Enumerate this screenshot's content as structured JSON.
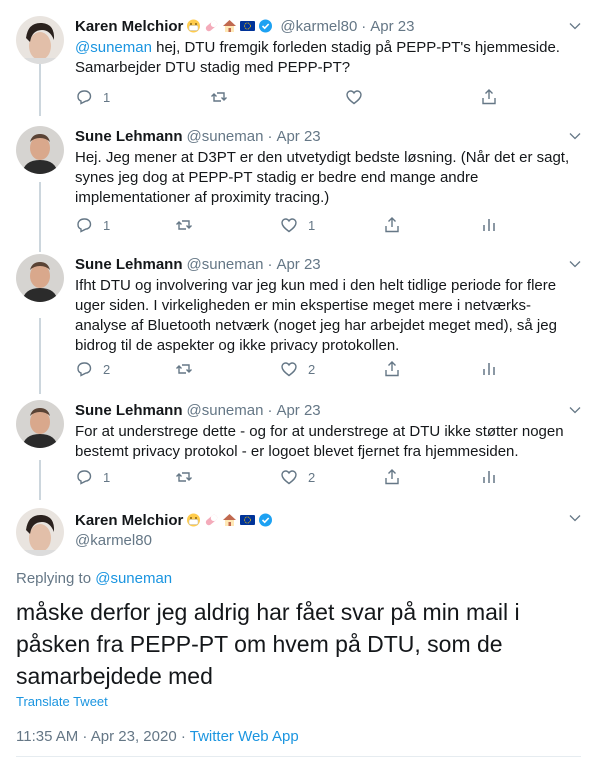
{
  "tweets": [
    {
      "name": "Karen Melchior",
      "handle": "@karmel80",
      "date": "Apr 23",
      "mention": "@suneman",
      "text": " hej, DTU fremgik forleden stadig på PEPP-PT's hjemmeside. Samarbejder DTU stadig med PEPP-PT?",
      "replies": "1",
      "retweets": "",
      "likes": ""
    },
    {
      "name": "Sune Lehmann",
      "handle": "@suneman",
      "date": "Apr 23",
      "text": "Hej. Jeg mener at D3PT er den utvetydigt bedste løsning. (Når det er sagt, synes jeg dog at PEPP-PT stadig er bedre end mange andre implementationer af proximity tracing.)",
      "replies": "1",
      "retweets": "",
      "likes": "1"
    },
    {
      "name": "Sune Lehmann",
      "handle": "@suneman",
      "date": "Apr 23",
      "text": "Ifht DTU og involvering var jeg kun med i den helt tidlige periode for flere uger siden. I virkeligheden er min ekspertise meget mere i netværks-analyse af Bluetooth netværk (noget jeg har arbejdet meget med), så jeg bidrog til de aspekter og ikke privacy protokollen.",
      "replies": "2",
      "retweets": "",
      "likes": "2"
    },
    {
      "name": "Sune Lehmann",
      "handle": "@suneman",
      "date": "Apr 23",
      "text": "For at understrege dette - og for at understrege at DTU ikke støtter nogen bestemt privacy protokol - er logoet blevet fjernet fra hjemmesiden.",
      "replies": "1",
      "retweets": "",
      "likes": "2"
    }
  ],
  "main": {
    "name": "Karen Melchior",
    "handle": "@karmel80",
    "replying_prefix": "Replying to ",
    "replying_to": "@suneman",
    "text": "måske derfor jeg aldrig har fået svar på min mail i påsken fra PEPP-PT om hvem på DTU, som de samarbejdede med",
    "translate": "Translate Tweet",
    "time": "11:35 AM · Apr 23, 2020 · ",
    "source": "Twitter Web App"
  },
  "ui": {
    "dot": "·"
  },
  "colors": {
    "link": "#1b95e0",
    "secondary": "#657786",
    "verified": "#1da1f2"
  }
}
